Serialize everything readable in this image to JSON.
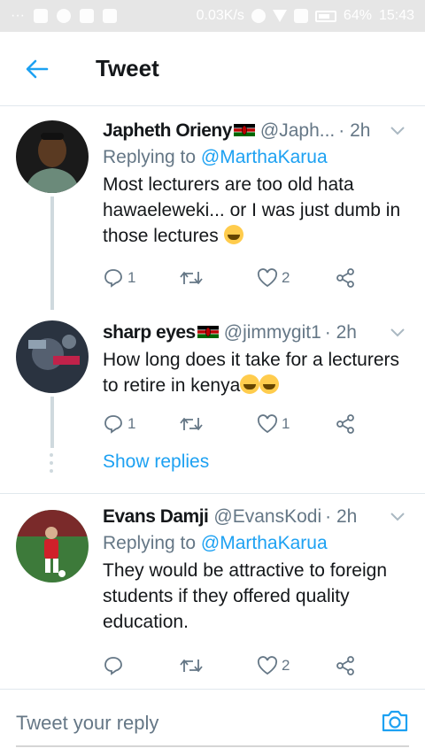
{
  "status_bar": {
    "network_speed": "0.03K/s",
    "battery": "64%",
    "time": "15:43"
  },
  "header": {
    "title": "Tweet"
  },
  "tweets": [
    {
      "name": "Japheth Orieny",
      "handle": "@Japh...",
      "time": "· 2h",
      "replying_prefix": "Replying to ",
      "replying_to": "@MarthaKarua",
      "text": "Most lecturers are too old hata hawaeleweki... or I was just dumb in those lectures",
      "reply_count": "1",
      "retweet_count": "",
      "like_count": "2"
    },
    {
      "name": "sharp eyes",
      "handle": "@jimmygit1",
      "time": "· 2h",
      "text": "How long does it take for a lecturers to retire in kenya",
      "reply_count": "1",
      "retweet_count": "",
      "like_count": "1"
    },
    {
      "name": "Evans Damji",
      "handle": "@EvansKodi",
      "time": "· 2h",
      "replying_prefix": "Replying to ",
      "replying_to": "@MarthaKarua",
      "text": "They would be attractive to foreign students if they offered quality education.",
      "reply_count": "",
      "retweet_count": "",
      "like_count": "2"
    }
  ],
  "show_replies": "Show replies",
  "reply_bar": {
    "placeholder": "Tweet your reply"
  },
  "colors": {
    "accent": "#1da1f2",
    "secondary_text": "#657786",
    "divider": "#e1e8ed"
  },
  "icons": [
    "back-arrow-icon",
    "chevron-down-icon",
    "reply-icon",
    "retweet-icon",
    "like-icon",
    "share-icon",
    "camera-icon",
    "kenya-flag-icon"
  ]
}
